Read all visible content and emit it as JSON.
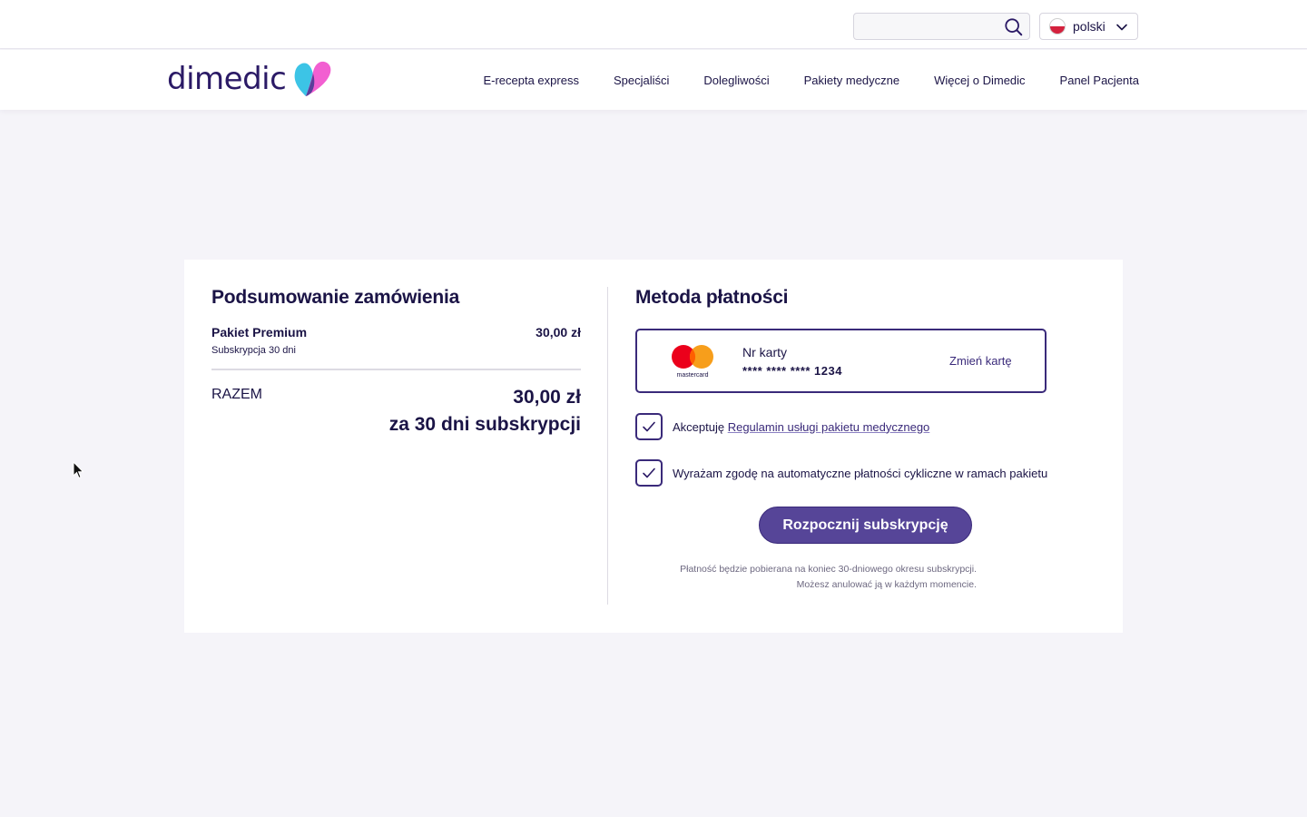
{
  "header": {
    "search": {
      "placeholder": "",
      "value": ""
    },
    "language": {
      "selected": "polski"
    },
    "logo_text": "dimedic",
    "nav": [
      "E-recepta express",
      "Specjaliści",
      "Dolegliwości",
      "Pakiety medyczne",
      "Więcej o Dimedic",
      "Panel Pacjenta"
    ]
  },
  "summary": {
    "title": "Podsumowanie zamówienia",
    "item": {
      "name": "Pakiet Premium",
      "subtitle": "Subskrypcja 30 dni",
      "price": "30,00 zł"
    },
    "total": {
      "label": "RAZEM",
      "amount": "30,00 zł",
      "period": "za 30 dni subskrypcji"
    }
  },
  "payment": {
    "title": "Metoda płatności",
    "card": {
      "brand_label": "mastercard",
      "label": "Nr karty",
      "masked": "**** **** **** 1234",
      "change": "Zmień kartę"
    },
    "terms": {
      "prefix": "Akceptuję ",
      "link": "Regulamin usługi pakietu medycznego",
      "checked": true
    },
    "consent": {
      "text": "Wyrażam zgodę na automatyczne płatności cykliczne w ramach pakietu",
      "checked": true
    },
    "cta": "Rozpocznij subskrypcję",
    "note_line1": "Płatność będzie pobierana na koniec 30-dniowego okresu subskrypcji.",
    "note_line2": "Możesz anulować ją w każdym momencie."
  },
  "colors": {
    "primary": "#564598",
    "text": "#1b1446",
    "background": "#f5f4f9"
  }
}
